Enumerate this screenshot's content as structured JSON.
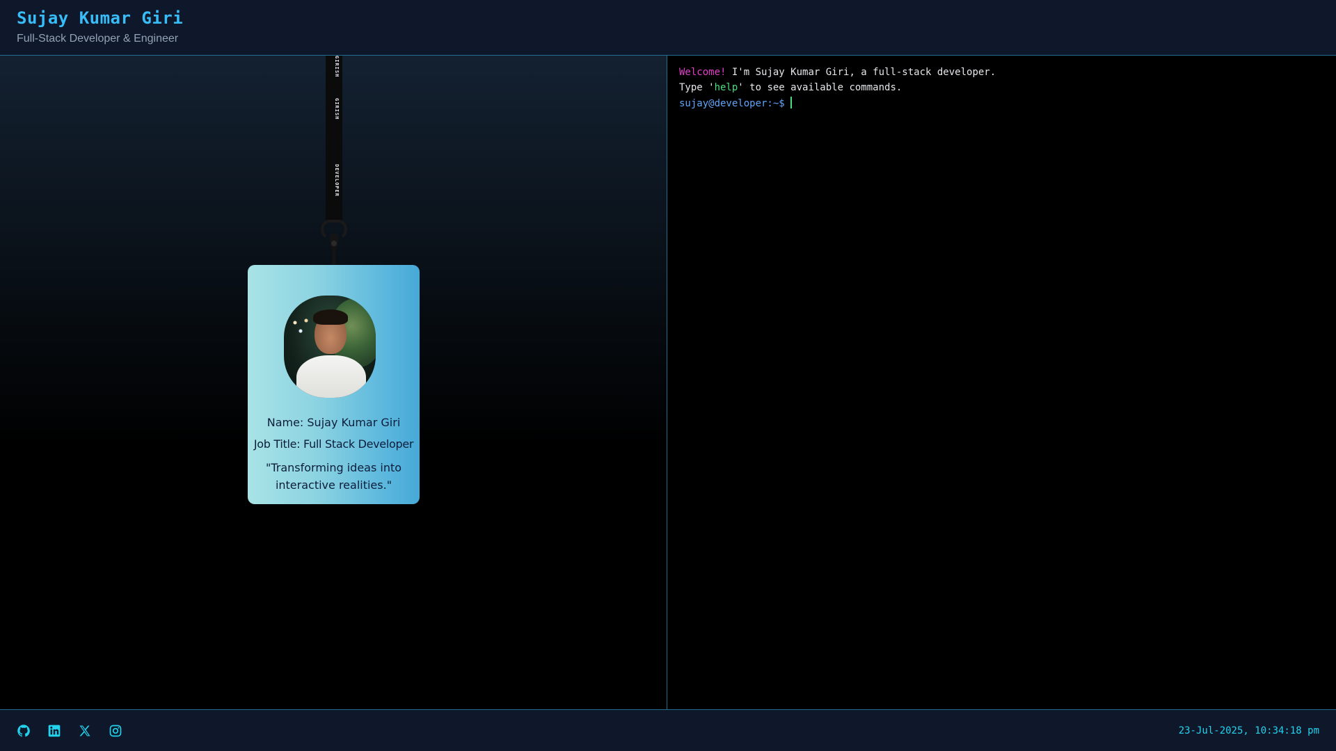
{
  "header": {
    "title": "Sujay Kumar Giri",
    "subtitle": "Full-Stack Developer & Engineer"
  },
  "lanyard": {
    "strap_labels": [
      "GIRISH",
      "GIRISH",
      "DEVELOPER"
    ]
  },
  "badge": {
    "name_line": "Name: Sujay Kumar Giri",
    "job_line": "Job Title: Full Stack Developer",
    "quote": "\"Transforming ideas into interactive realities.\""
  },
  "terminal": {
    "welcome_word": "Welcome!",
    "welcome_rest": " I'm Sujay Kumar Giri, a full-stack developer.",
    "type_prefix": "Type '",
    "help_word": "help",
    "type_suffix": "' to see available commands.",
    "prompt": "sujay@developer:~$",
    "input_value": ""
  },
  "footer": {
    "icons": [
      "github-icon",
      "linkedin-icon",
      "x-icon",
      "instagram-icon"
    ],
    "timestamp": "23-Jul-2025, 10:34:18 pm"
  },
  "colors": {
    "accent": "#38bdf8",
    "footer_text": "#22d3ee",
    "welcome": "#e040c8",
    "help": "#4ade80",
    "prompt": "#60a5fa",
    "bar_bg": "#0f172a"
  }
}
